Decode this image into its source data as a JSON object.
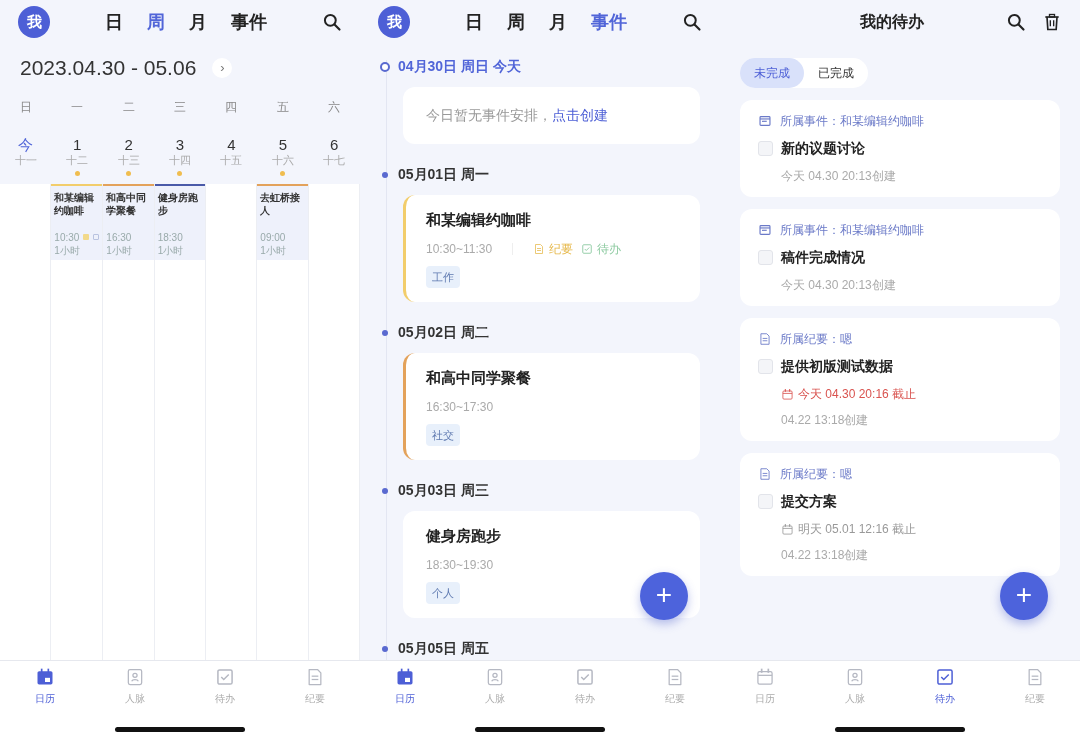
{
  "screens": [
    {
      "kind": "week",
      "avatar": "我",
      "view_tabs": [
        {
          "label": "日",
          "selected": false
        },
        {
          "label": "周",
          "selected": true
        },
        {
          "label": "月",
          "selected": false
        },
        {
          "label": "事件",
          "selected": false
        }
      ],
      "range": "2023.04.30 - 05.06",
      "next": "›",
      "weekdays": [
        "日",
        "一",
        "二",
        "三",
        "四",
        "五",
        "六"
      ],
      "days": [
        {
          "day": "今",
          "lunar": "十一",
          "today": true,
          "has_events": false
        },
        {
          "day": "1",
          "lunar": "十二",
          "today": false,
          "has_events": true,
          "events": [
            {
              "title": "和某编辑约咖啡",
              "time": "10:30",
              "duration": "1小时",
              "color": "#f2cd6b",
              "note": true,
              "todo": true
            }
          ]
        },
        {
          "day": "2",
          "lunar": "十三",
          "today": false,
          "has_events": true,
          "events": [
            {
              "title": "和高中同学聚餐",
              "time": "16:30",
              "duration": "1小时",
              "color": "#e3a25b",
              "note": false,
              "todo": false
            }
          ]
        },
        {
          "day": "3",
          "lunar": "十四",
          "today": false,
          "has_events": true,
          "events": [
            {
              "title": "健身房跑步",
              "time": "18:30",
              "duration": "1小时",
              "color": "#4a5aa8",
              "note": false,
              "todo": false
            }
          ]
        },
        {
          "day": "4",
          "lunar": "十五",
          "today": false,
          "has_events": false
        },
        {
          "day": "5",
          "lunar": "十六",
          "today": false,
          "has_events": true,
          "events": [
            {
              "title": "去虹桥接人",
              "time": "09:00",
              "duration": "1小时",
              "color": "#e3a25b",
              "note": false,
              "todo": false
            }
          ]
        },
        {
          "day": "6",
          "lunar": "十七",
          "today": false,
          "has_events": false
        }
      ],
      "nav": [
        {
          "kind": "calendar",
          "label": "日历",
          "selected": true
        },
        {
          "kind": "contacts",
          "label": "人脉",
          "selected": false
        },
        {
          "kind": "todo",
          "label": "待办",
          "selected": false
        },
        {
          "kind": "notes",
          "label": "纪要",
          "selected": false
        }
      ]
    },
    {
      "kind": "timeline",
      "avatar": "我",
      "view_tabs": [
        {
          "label": "日",
          "selected": false
        },
        {
          "label": "周",
          "selected": false
        },
        {
          "label": "月",
          "selected": false
        },
        {
          "label": "事件",
          "selected": true
        }
      ],
      "groups": [
        {
          "date": "04月30日 周日 今天",
          "today": true,
          "empty": {
            "text": "今日暂无事件安排，",
            "link": "点击创建"
          }
        },
        {
          "date": "05月01日 周一",
          "today": false,
          "events": [
            {
              "title": "和某编辑约咖啡",
              "time": "10:30~11:30",
              "color": "#f2cd6b",
              "links": [
                {
                  "kind": "note",
                  "label": "纪要"
                },
                {
                  "kind": "todo",
                  "label": "待办"
                }
              ],
              "tag": "工作"
            }
          ]
        },
        {
          "date": "05月02日 周二",
          "today": false,
          "events": [
            {
              "title": "和高中同学聚餐",
              "time": "16:30~17:30",
              "color": "#e3a25b",
              "tag": "社交"
            }
          ]
        },
        {
          "date": "05月03日 周三",
          "today": false,
          "events": [
            {
              "title": "健身房跑步",
              "time": "18:30~19:30",
              "color": "#ffffff",
              "tag": "个人"
            }
          ]
        },
        {
          "date": "05月05日 周五",
          "today": false
        }
      ],
      "fab": "+",
      "nav": [
        {
          "kind": "calendar",
          "label": "日历",
          "selected": true
        },
        {
          "kind": "contacts",
          "label": "人脉",
          "selected": false
        },
        {
          "kind": "todo",
          "label": "待办",
          "selected": false
        },
        {
          "kind": "notes",
          "label": "纪要",
          "selected": false
        }
      ]
    },
    {
      "kind": "todos",
      "title": "我的待办",
      "segments": [
        {
          "label": "未完成",
          "selected": true
        },
        {
          "label": "已完成",
          "selected": false
        }
      ],
      "todos": [
        {
          "kind": "event",
          "source": "所属事件：和某编辑约咖啡",
          "title": "新的议题讨论",
          "checked": false,
          "created": "今天 04.30 20:13创建"
        },
        {
          "kind": "event",
          "source": "所属事件：和某编辑约咖啡",
          "title": "稿件完成情况",
          "checked": false,
          "created": "今天 04.30 20:13创建"
        },
        {
          "kind": "note",
          "source": "所属纪要：嗯",
          "title": "提供初版测试数据",
          "checked": false,
          "deadline": {
            "text": "今天 04.30 20:16 截止",
            "overdue": true
          },
          "created": "04.22 13:18创建"
        },
        {
          "kind": "note",
          "source": "所属纪要：嗯",
          "title": "提交方案",
          "checked": false,
          "deadline": {
            "text": "明天 05.01 12:16 截止",
            "overdue": false
          },
          "created": "04.22 13:18创建"
        }
      ],
      "fab": "+",
      "nav": [
        {
          "kind": "calendar",
          "label": "日历",
          "selected": false
        },
        {
          "kind": "contacts",
          "label": "人脉",
          "selected": false
        },
        {
          "kind": "todo",
          "label": "待办",
          "selected": true
        },
        {
          "kind": "notes",
          "label": "纪要",
          "selected": false
        }
      ]
    }
  ]
}
